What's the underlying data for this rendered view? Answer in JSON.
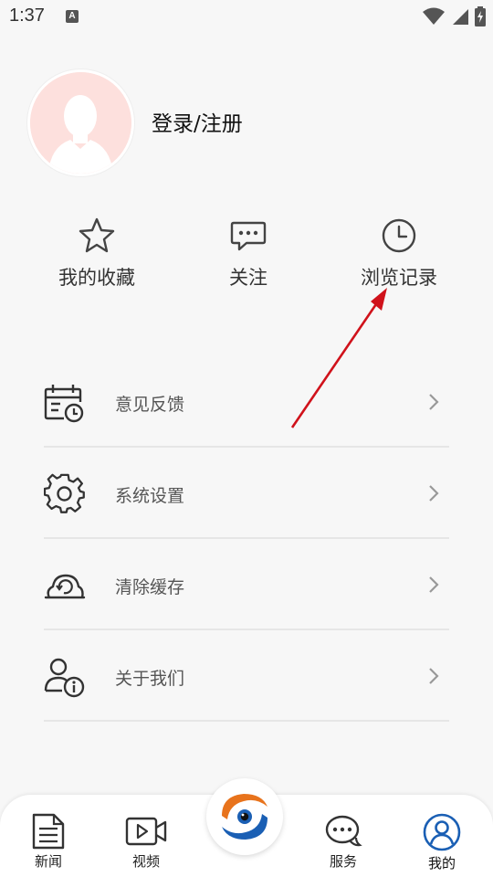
{
  "status_bar": {
    "time": "1:37",
    "notification_icon_letter": "A",
    "icons": [
      "wifi-icon",
      "signal-icon",
      "battery-charging-icon"
    ]
  },
  "profile": {
    "login_label": "登录/注册",
    "avatar_bg": "#fde0dd"
  },
  "quick_actions": [
    {
      "label": "我的收藏",
      "icon": "star-icon"
    },
    {
      "label": "关注",
      "icon": "chat-bubble-icon"
    },
    {
      "label": "浏览记录",
      "icon": "clock-icon"
    }
  ],
  "menu": [
    {
      "label": "意见反馈",
      "icon": "calendar-clock-icon"
    },
    {
      "label": "系统设置",
      "icon": "gear-icon"
    },
    {
      "label": "清除缓存",
      "icon": "cloud-refresh-icon"
    },
    {
      "label": "关于我们",
      "icon": "user-info-icon"
    }
  ],
  "annotation": {
    "type": "red-arrow",
    "color": "#d0121b",
    "points_to": "浏览记录"
  },
  "tabbar": {
    "tabs": [
      {
        "label": "新闻",
        "icon": "news-icon",
        "active": false
      },
      {
        "label": "视频",
        "icon": "video-icon",
        "active": false
      },
      {
        "label": "服务",
        "icon": "service-chat-icon",
        "active": false
      },
      {
        "label": "我的",
        "icon": "profile-icon",
        "active": true
      }
    ],
    "center_icon": "app-logo-icon",
    "accent_color": "#1a5fb4",
    "logo_orange": "#e8731c"
  }
}
